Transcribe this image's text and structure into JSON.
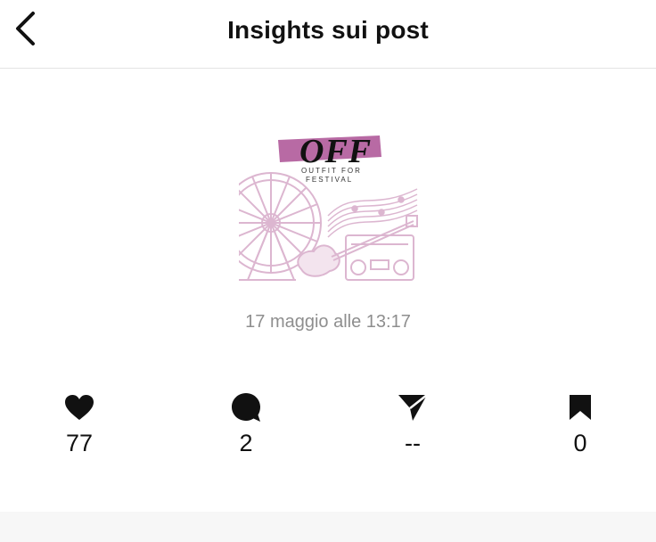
{
  "header": {
    "title": "Insights sui post"
  },
  "post": {
    "thumbnail": {
      "logo_text": "OFF",
      "tagline_line1": "OUTFIT FOR",
      "tagline_line2": "FESTIVAL",
      "accent_color": "#b86aa4",
      "art_color": "#dcb6d0"
    },
    "timestamp": "17 maggio alle 13:17"
  },
  "stats": {
    "likes": "77",
    "comments": "2",
    "shares": "--",
    "saves": "0"
  },
  "icons": {
    "back": "chevron-left-icon",
    "likes": "heart-icon",
    "comments": "comment-bubble-icon",
    "shares": "paper-plane-icon",
    "saves": "bookmark-icon"
  }
}
